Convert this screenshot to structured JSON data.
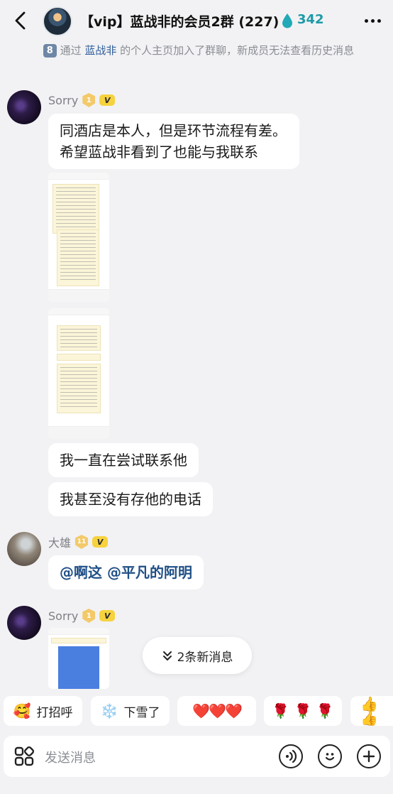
{
  "header": {
    "title": "【vip】蓝战非的会员2群 (227)",
    "drop_count": "342"
  },
  "notice": {
    "badge": "8",
    "prefix": "通过",
    "link": "蓝战非",
    "suffix": "的个人主页加入了群聊，新成员无法查看历史消息"
  },
  "messages": {
    "sorry_name": "Sorry",
    "sorry_level": "1",
    "vip_badge": "V",
    "text1_line1": "同酒店是本人，但是环节流程有差。",
    "text1_line2": "希望蓝战非看到了也能与我联系",
    "text2": "我一直在尝试联系他",
    "text3": "我甚至没有存他的电话",
    "daxiong_name": "大雄",
    "daxiong_level": "11",
    "mention": "@啊这 @平凡的阿明",
    "sorry2_name": "Sorry"
  },
  "new_messages": "2条新消息",
  "quick_replies": [
    {
      "label": "打招呼",
      "icon": "🥰"
    },
    {
      "label": "下雪了",
      "icon": "❄️"
    },
    {
      "label": "",
      "icon": "❤️❤️❤️"
    },
    {
      "label": "",
      "icon": "🌹 🌹 🌹"
    },
    {
      "label": "",
      "icon": "👍👍"
    }
  ],
  "input": {
    "placeholder": "发送消息"
  }
}
